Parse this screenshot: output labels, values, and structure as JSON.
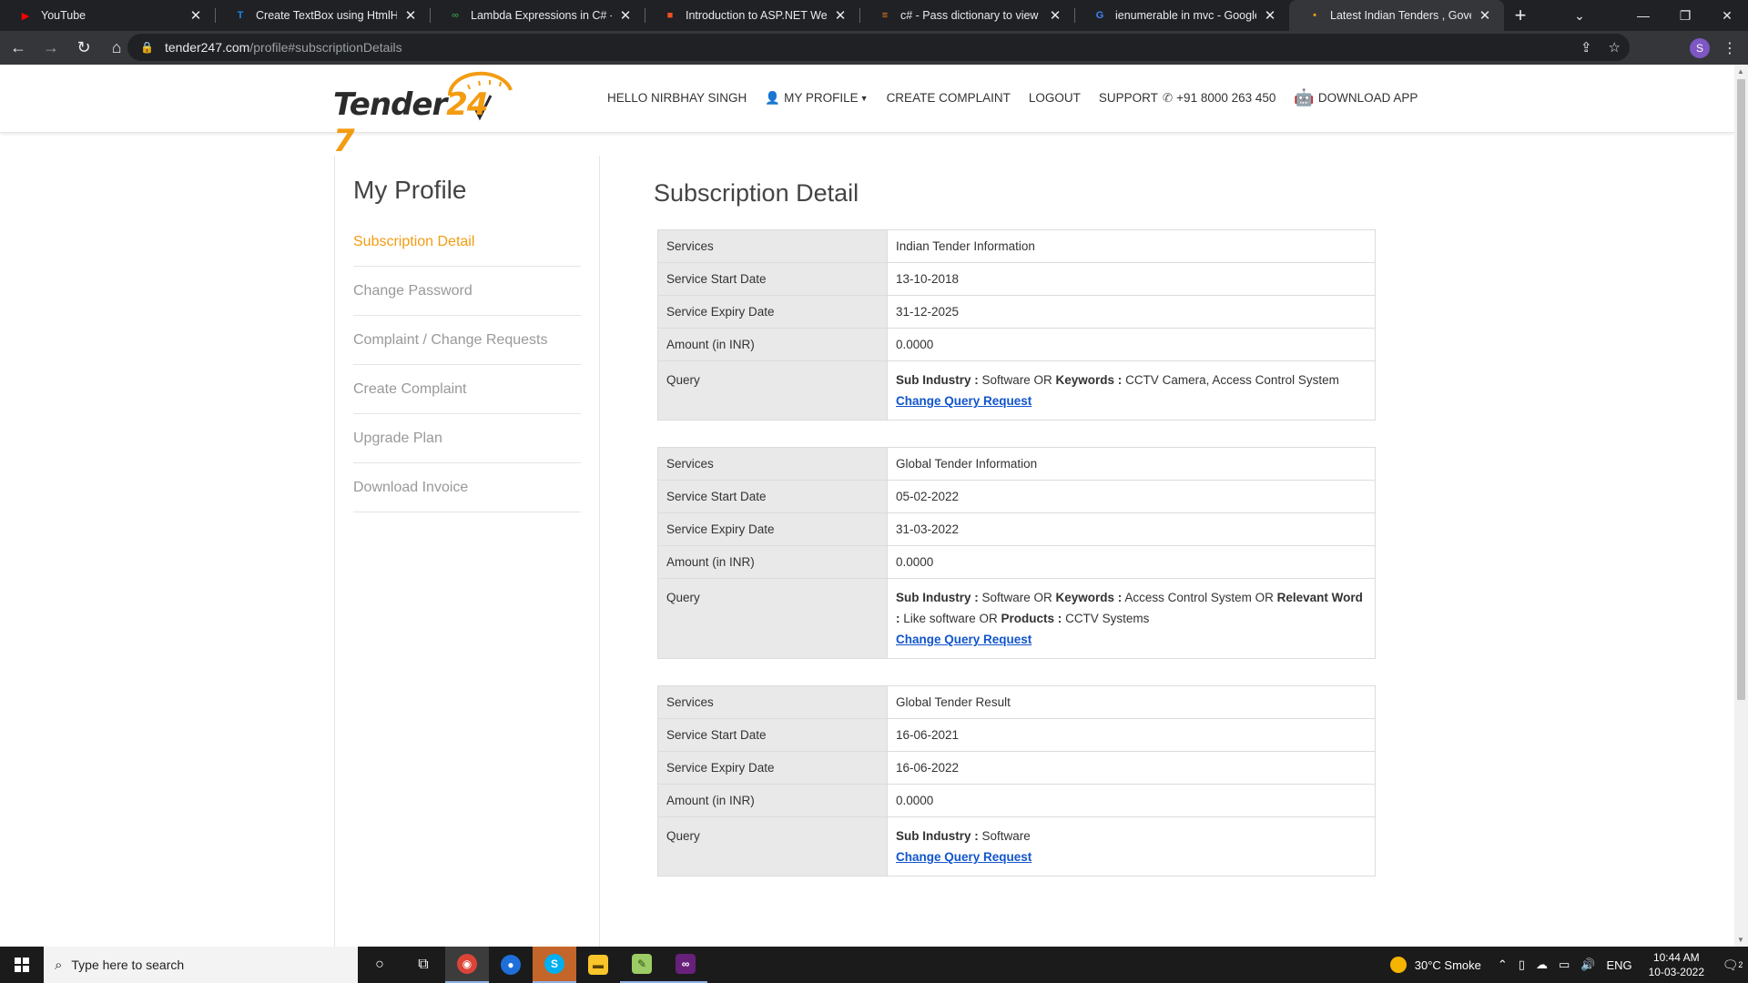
{
  "browser": {
    "tabs": [
      {
        "title": "YouTube",
        "icon": "youtube-icon",
        "color": "#ff0000",
        "glyph": "▶"
      },
      {
        "title": "Create TextBox using HtmlHelpe",
        "icon": "site-icon",
        "color": "#1e88e5",
        "glyph": "T"
      },
      {
        "title": "Lambda Expressions in C# - Gee",
        "icon": "geeks-icon",
        "color": "#2f8d46",
        "glyph": "∞"
      },
      {
        "title": "Introduction to ASP.NET Web Pr",
        "icon": "microsoft-icon",
        "color": "#f25022",
        "glyph": "■"
      },
      {
        "title": "c# - Pass dictionary to view and",
        "icon": "stackoverflow-icon",
        "color": "#f48024",
        "glyph": "≡"
      },
      {
        "title": "ienumerable in mvc - Google Se",
        "icon": "google-icon",
        "color": "#4285f4",
        "glyph": "G"
      },
      {
        "title": "Latest Indian Tenders , Governm",
        "icon": "loading-icon",
        "color": "#f39c12",
        "glyph": "•"
      }
    ],
    "url_host": "tender247.com",
    "url_path": "/profile#subscriptionDetails",
    "profile_initial": "S"
  },
  "header": {
    "logo_word": "Tender",
    "logo_num": "24",
    "logo_suffix": "7",
    "greeting": "HELLO NIRBHAY SINGH",
    "my_profile": "MY PROFILE",
    "create_complaint": "CREATE COMPLAINT",
    "logout": "LOGOUT",
    "support": "SUPPORT",
    "phone": "+91 8000 263 450",
    "download_app": "DOWNLOAD APP"
  },
  "sidebar": {
    "title": "My Profile",
    "items": [
      {
        "label": "Subscription Detail",
        "active": true
      },
      {
        "label": "Change Password",
        "active": false
      },
      {
        "label": "Complaint / Change Requests",
        "active": false
      },
      {
        "label": "Create Complaint",
        "active": false
      },
      {
        "label": "Upgrade Plan",
        "active": false
      },
      {
        "label": "Download Invoice",
        "active": false
      }
    ]
  },
  "main": {
    "title": "Subscription Detail",
    "labels": {
      "services": "Services",
      "start": "Service Start Date",
      "expiry": "Service Expiry Date",
      "amount": "Amount (in INR)",
      "query": "Query"
    },
    "link_label": "Change Query Request",
    "subscriptions": [
      {
        "service": "Indian Tender Information",
        "start": "13-10-2018",
        "expiry": "31-12-2025",
        "amount": "0.0000",
        "query": [
          {
            "k": "Sub Industry :",
            "v": " Software OR "
          },
          {
            "k": "Keywords :",
            "v": " CCTV Camera, Access Control System"
          }
        ]
      },
      {
        "service": "Global Tender Information",
        "start": "05-02-2022",
        "expiry": "31-03-2022",
        "amount": "0.0000",
        "query": [
          {
            "k": "Sub Industry :",
            "v": " Software OR "
          },
          {
            "k": "Keywords :",
            "v": " Access Control System OR "
          },
          {
            "k": "Relevant Word :",
            "v": " Like software OR "
          },
          {
            "k": "Products :",
            "v": " CCTV Systems"
          }
        ]
      },
      {
        "service": "Global Tender Result",
        "start": "16-06-2021",
        "expiry": "16-06-2022",
        "amount": "0.0000",
        "query": [
          {
            "k": "Sub Industry :",
            "v": " Software"
          }
        ]
      }
    ]
  },
  "taskbar": {
    "search_placeholder": "Type here to search",
    "weather": "30°C  Smoke",
    "lang": "ENG",
    "time": "10:44 AM",
    "date": "10-03-2022",
    "notifications": "2"
  },
  "colors": {
    "accent": "#f39c12",
    "link": "#1155cc",
    "label_bg": "#e9e9e9"
  }
}
